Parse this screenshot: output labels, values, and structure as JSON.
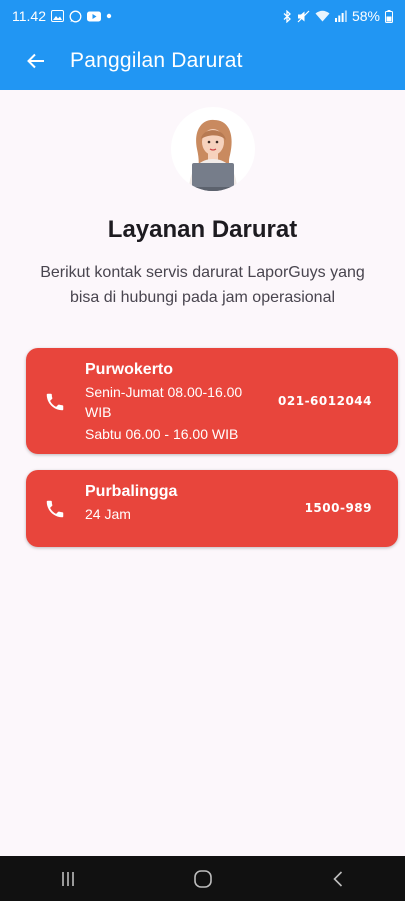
{
  "status_bar": {
    "time": "11.42",
    "battery": "58%"
  },
  "app_bar": {
    "title": "Panggilan Darurat"
  },
  "header": {
    "title": "Layanan Darurat",
    "description": "Berikut kontak servis darurat LaporGuys yang bisa di hubungi pada jam operasional"
  },
  "contacts": [
    {
      "city": "Purwokerto",
      "hours": [
        "Senin-Jumat 08.00-16.00 WIB",
        "Sabtu 06.00 - 16.00 WIB"
      ],
      "number": "021-6012044"
    },
    {
      "city": "Purbalingga",
      "hours": [
        "24 Jam"
      ],
      "number": "1500-989"
    }
  ],
  "colors": {
    "primary": "#2196f3",
    "card": "#e8453c",
    "background": "#fcf7fb"
  }
}
